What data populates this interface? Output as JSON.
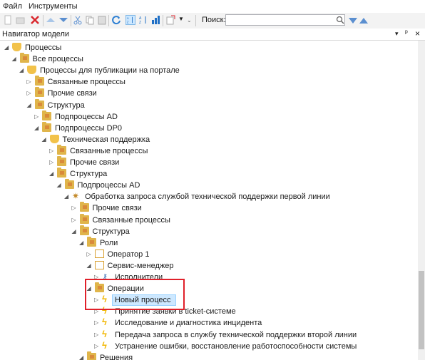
{
  "menu": {
    "file": "Файл",
    "tools": "Инструменты"
  },
  "toolbar": {
    "search_label": "Поиск:",
    "search_value": ""
  },
  "panel": {
    "title": "Навигатор модели",
    "pin": "ᵖ",
    "close": "×",
    "dropdown": "▾"
  },
  "tree": [
    {
      "label": "Процессы",
      "level": 0,
      "icon": "process",
      "expanded": true
    },
    {
      "label": "Все процессы",
      "level": 1,
      "icon": "folder",
      "expanded": true
    },
    {
      "label": "Процессы для публикации на портале",
      "level": 2,
      "icon": "process",
      "expanded": true
    },
    {
      "label": "Связанные процессы",
      "level": 3,
      "icon": "folder",
      "expanded": false
    },
    {
      "label": "Прочие связи",
      "level": 3,
      "icon": "folder",
      "expanded": false
    },
    {
      "label": "Структура",
      "level": 3,
      "icon": "folder",
      "expanded": true
    },
    {
      "label": "Подпроцессы AD",
      "level": 4,
      "icon": "folder",
      "expanded": false
    },
    {
      "label": "Подпроцессы DP0",
      "level": 4,
      "icon": "folder",
      "expanded": true
    },
    {
      "label": "Техническая поддержка",
      "level": 5,
      "icon": "process",
      "expanded": true
    },
    {
      "label": "Связанные процессы",
      "level": 6,
      "icon": "folder",
      "expanded": false
    },
    {
      "label": "Прочие связи",
      "level": 6,
      "icon": "folder",
      "expanded": false
    },
    {
      "label": "Структура",
      "level": 6,
      "icon": "folder",
      "expanded": true
    },
    {
      "label": "Подпроцессы AD",
      "level": 7,
      "icon": "folder",
      "expanded": true
    },
    {
      "label": "Обработка запроса службой технической поддержки первой линии",
      "level": 8,
      "icon": "gear",
      "expanded": true
    },
    {
      "label": "Прочие связи",
      "level": 9,
      "icon": "folder",
      "expanded": false
    },
    {
      "label": "Связанные процессы",
      "level": 9,
      "icon": "folder",
      "expanded": false
    },
    {
      "label": "Структура",
      "level": 9,
      "icon": "folder",
      "expanded": true
    },
    {
      "label": "Роли",
      "level": 10,
      "icon": "folder",
      "expanded": true
    },
    {
      "label": "Оператор 1",
      "level": 11,
      "icon": "doc",
      "expanded": false
    },
    {
      "label": "Сервис-менеджер",
      "level": 11,
      "icon": "doc",
      "expanded": true
    },
    {
      "label": "Исполнители",
      "level": 12,
      "icon": "key",
      "expanded": false
    },
    {
      "label": "Операции",
      "level": 11,
      "icon": "folder",
      "expanded": true
    },
    {
      "label": "Новый процесс",
      "level": 12,
      "icon": "bolt",
      "expanded": false,
      "selected": true
    },
    {
      "label": "Принятие заявки в ticket-системе",
      "level": 12,
      "icon": "bolt",
      "expanded": false
    },
    {
      "label": "Исследование и диагностика инцидента",
      "level": 12,
      "icon": "bolt",
      "expanded": false
    },
    {
      "label": "Передача запроса в службу технической поддержки второй линии",
      "level": 12,
      "icon": "bolt",
      "expanded": false
    },
    {
      "label": "Устранение ошибки, восстановление работоспособности системы",
      "level": 12,
      "icon": "bolt",
      "expanded": false
    },
    {
      "label": "Решения",
      "level": 10,
      "icon": "folder",
      "expanded": true
    }
  ]
}
